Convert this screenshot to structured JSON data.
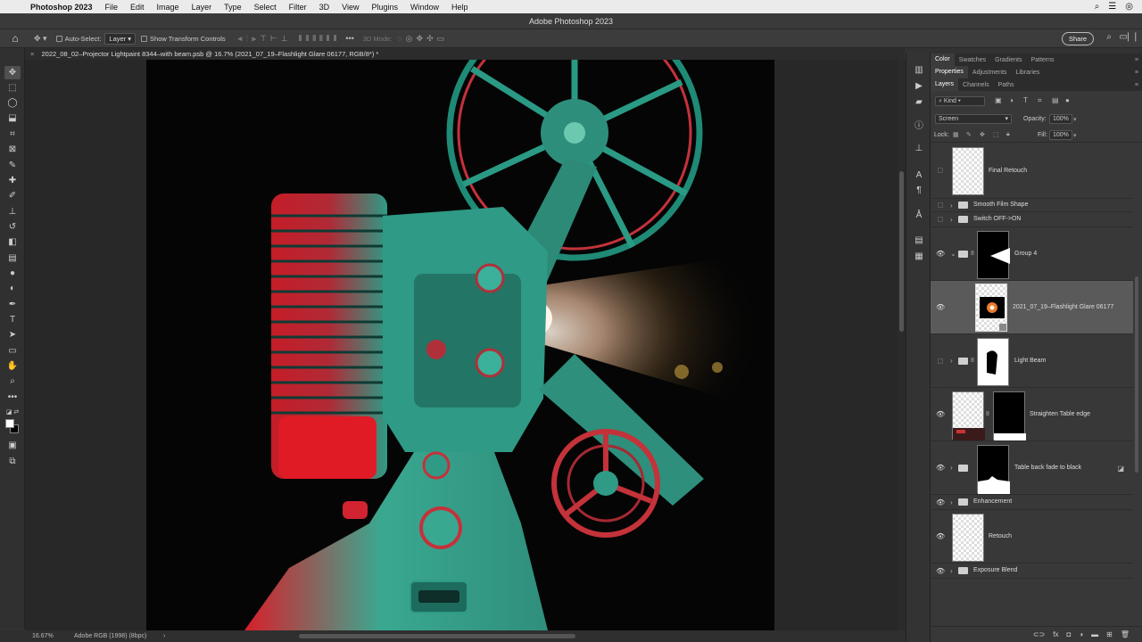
{
  "menubar": {
    "app_name": "Photoshop 2023",
    "items": [
      "File",
      "Edit",
      "Image",
      "Layer",
      "Type",
      "Select",
      "Filter",
      "3D",
      "View",
      "Plugins",
      "Window",
      "Help"
    ]
  },
  "window": {
    "title": "Adobe Photoshop 2023"
  },
  "options": {
    "auto_select_label": "Auto-Select:",
    "auto_select_value": "Layer",
    "transform_label": "Show Transform Controls",
    "mode_label": "3D Mode:",
    "share_label": "Share"
  },
  "document": {
    "tab_title": "2022_08_02–Projector Lightpaint 8344–with beam.psb @ 16.7% (2021_07_19–Flashlight Glare 06177, RGB/8*) *"
  },
  "status": {
    "zoom": "16.67%",
    "profile": "Adobe RGB (1998) (8bpc)",
    "arrow": "›"
  },
  "panels": {
    "row1_tabs": [
      "Color",
      "Swatches",
      "Gradients",
      "Patterns"
    ],
    "row2_tabs": [
      "Properties",
      "Adjustments",
      "Libraries"
    ],
    "row3_tabs": [
      "Layers",
      "Channels",
      "Paths"
    ],
    "filter_kind": "Kind",
    "blend_mode": "Screen",
    "opacity_label": "Opacity:",
    "opacity_value": "100%",
    "lock_label": "Lock:",
    "fill_label": "Fill:",
    "fill_value": "100%"
  },
  "layers": [
    {
      "name": "Final Retouch",
      "visible": false,
      "type": "pixel"
    },
    {
      "name": "Smooth Film Shape",
      "visible": false,
      "type": "group"
    },
    {
      "name": "Switch OFF->ON",
      "visible": false,
      "type": "group"
    },
    {
      "name": "Group 4",
      "visible": true,
      "type": "group-mask"
    },
    {
      "name": "2021_07_19–Flashlight Glare 06177",
      "visible": true,
      "type": "smart",
      "selected": true
    },
    {
      "name": "Light Beam",
      "visible": false,
      "type": "group-mask"
    },
    {
      "name": "Straighten Table edge",
      "visible": true,
      "type": "pixel-mask"
    },
    {
      "name": "Table back fade to black",
      "visible": true,
      "type": "group-mask"
    },
    {
      "name": "Enhancement",
      "visible": true,
      "type": "group"
    },
    {
      "name": "Retouch",
      "visible": true,
      "type": "pixel"
    },
    {
      "name": "Exposure Blend",
      "visible": true,
      "type": "group"
    }
  ]
}
